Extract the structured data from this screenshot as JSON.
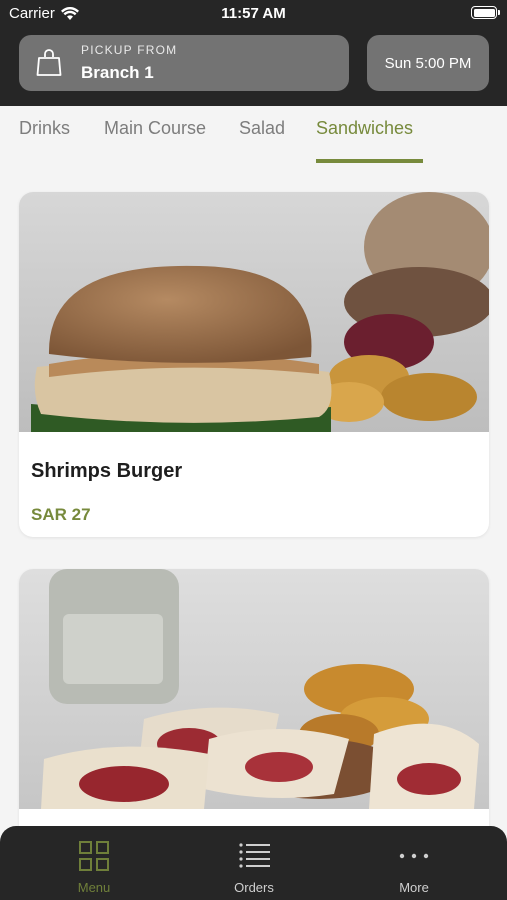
{
  "status_bar": {
    "carrier": "Carrier",
    "time": "11:57 AM"
  },
  "header": {
    "pickup_label": "PICKUP FROM",
    "branch": "Branch 1",
    "pickup_time": "Sun 5:00 PM"
  },
  "tabs": [
    {
      "label": "Drinks"
    },
    {
      "label": "Main Course"
    },
    {
      "label": "Salad"
    },
    {
      "label": "Sandwiches",
      "active": true
    }
  ],
  "items": [
    {
      "name": "Shrimps Burger",
      "price": "SAR 27"
    },
    {
      "name": "",
      "price": ""
    }
  ],
  "nav": [
    {
      "label": "Menu",
      "icon": "grid-icon",
      "active": true
    },
    {
      "label": "Orders",
      "icon": "list-icon"
    },
    {
      "label": "More",
      "icon": "more-icon"
    }
  ],
  "colors": {
    "accent": "#778a3c",
    "header_bg": "#262626",
    "box_bg": "#737373"
  }
}
